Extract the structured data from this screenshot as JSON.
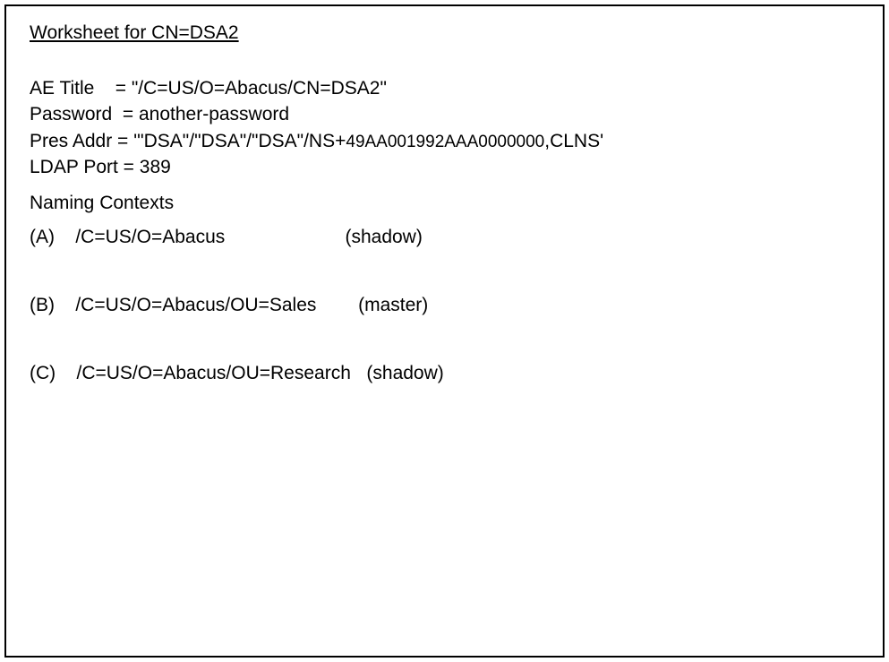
{
  "title": "Worksheet for CN=DSA2",
  "fields": {
    "ae_title_label": "AE Title",
    "ae_title_value": "\"/C=US/O=Abacus/CN=DSA2\"",
    "password_label": "Password",
    "password_value": "another-password",
    "pres_addr_label": "Pres Addr",
    "pres_addr_prefix": "'\"DSA\"/\"DSA\"/\"DSA\"/NS+",
    "pres_addr_hex": "49AA001992AAA0000000",
    "pres_addr_suffix": ",CLNS'",
    "ldap_port_label": "LDAP Port",
    "ldap_port_value": "389"
  },
  "naming_contexts_header": "Naming Contexts",
  "contexts": [
    {
      "letter": "(A)",
      "path": "/C=US/O=Abacus",
      "role": "(shadow)"
    },
    {
      "letter": "(B)",
      "path": "/C=US/O=Abacus/OU=Sales",
      "role": "(master)"
    },
    {
      "letter": "(C)",
      "path": "/C=US/O=Abacus/OU=Research",
      "role": "(shadow)"
    }
  ]
}
